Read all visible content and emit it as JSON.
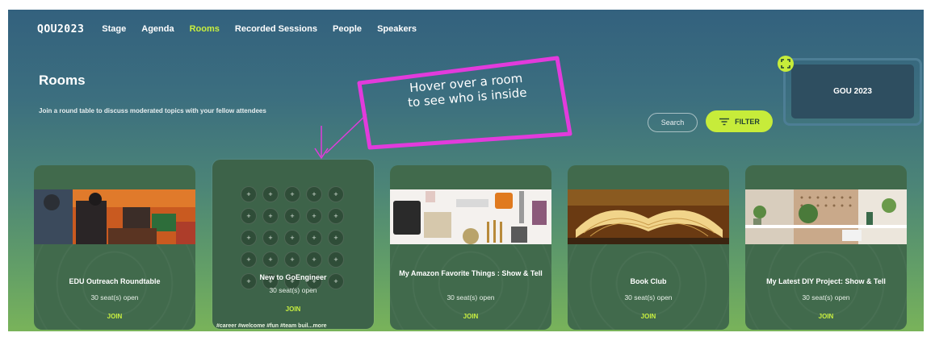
{
  "nav": {
    "logo": "QOU2023",
    "items": [
      {
        "label": "Stage",
        "active": false
      },
      {
        "label": "Agenda",
        "active": false
      },
      {
        "label": "Rooms",
        "active": true
      },
      {
        "label": "Recorded Sessions",
        "active": false
      },
      {
        "label": "People",
        "active": false
      },
      {
        "label": "Speakers",
        "active": false
      }
    ]
  },
  "page": {
    "title": "Rooms",
    "subtitle": "Join a round table to discuss moderated topics with your fellow attendees"
  },
  "controls": {
    "search_label": "Search",
    "filter_label": "FILTER"
  },
  "stream_panel": {
    "label": "GOU 2023"
  },
  "rooms": [
    {
      "title": "EDU Outreach Roundtable",
      "seats": "30 seat(s) open",
      "join": "JOIN"
    },
    {
      "title": "New to GoEngineer",
      "seats": "30 seat(s) open",
      "join": "JOIN",
      "tags": "#career #welcome #fun #team buil...more"
    },
    {
      "title": "My Amazon Favorite Things : Show & Tell",
      "seats": "30 seat(s) open",
      "join": "JOIN"
    },
    {
      "title": "Book Club",
      "seats": "30 seat(s) open",
      "join": "JOIN"
    },
    {
      "title": "My Latest DIY Project: Show & Tell",
      "seats": "30 seat(s) open",
      "join": "JOIN"
    }
  ],
  "annotation": {
    "line1": "Hover over a room",
    "line2": "to see who is inside"
  },
  "colors": {
    "accent": "#c7ec3a",
    "callout": "#e23bdc",
    "card": "#416a4c"
  }
}
